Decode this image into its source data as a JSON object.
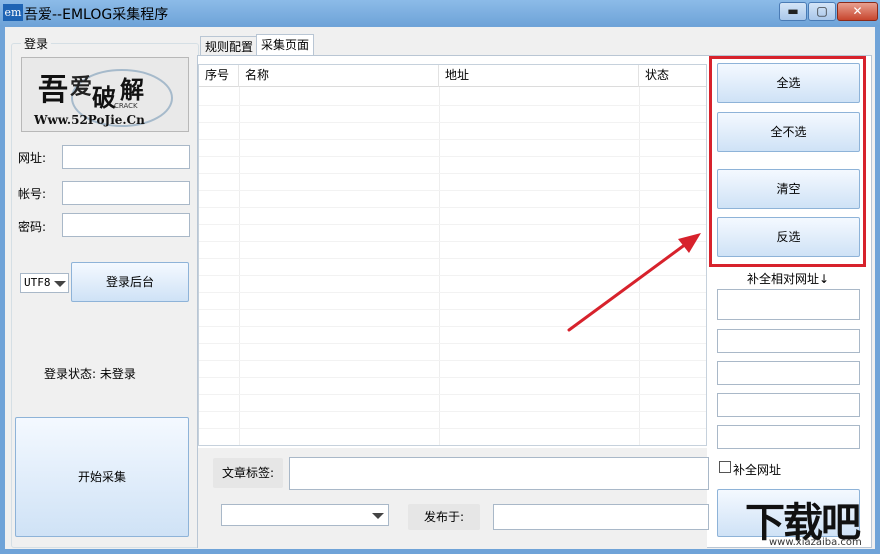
{
  "window": {
    "icon_text": "em",
    "title": "吾爱--EMLOG采集程序",
    "minimize_glyph": "▬",
    "maximize_glyph": "▢",
    "close_glyph": "✕"
  },
  "login": {
    "group_label": "登录",
    "logo_alt": "吾爱破解 CRACK Www.52PoJie.Cn",
    "url_label": "网址:",
    "url_value": "",
    "account_label": "帐号:",
    "account_value": "",
    "password_label": "密码:",
    "password_value": "",
    "encoding_value": "UTF8",
    "login_button": "登录后台",
    "status_text": "登录状态: 未登录",
    "start_button": "开始采集"
  },
  "tabs": [
    {
      "label": "规则配置",
      "active": false
    },
    {
      "label": "采集页面",
      "active": true
    }
  ],
  "list": {
    "columns": [
      "序号",
      "名称",
      "地址",
      "状态"
    ],
    "rows": []
  },
  "selection": {
    "select_all": "全选",
    "select_none": "全不选",
    "clear": "清空",
    "invert": "反选",
    "relative_url_label": "补全相对网址↓",
    "relative_url_fields": [
      "",
      "",
      "",
      "",
      "",
      ""
    ],
    "complete_url_checkbox_label": "补全网址",
    "complete_url_checked": false
  },
  "article": {
    "tag_label": "文章标签:",
    "tag_value": "",
    "category_value": "",
    "publish_label": "发布于:",
    "publish_value": ""
  },
  "annotation": {
    "highlight_color": "#d7222c",
    "arrow_color": "#d7222c"
  },
  "watermark": {
    "main": "下载吧",
    "sub": "www.xiazaiba.com"
  }
}
